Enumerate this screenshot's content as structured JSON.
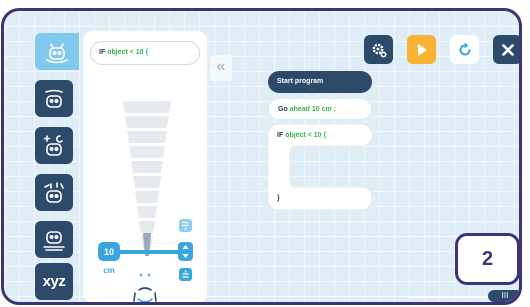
{
  "palette": {
    "if_block": {
      "keyword": "IF",
      "condition": "object < 10 {"
    },
    "sensor": {
      "value": "10",
      "unit": "cm"
    }
  },
  "program": {
    "start": "Start program",
    "go": {
      "keyword": "Go",
      "condition": "ahead 10 cm ;"
    },
    "if_block": {
      "keyword": "IF",
      "condition": "object < 10 {",
      "close": "}"
    }
  },
  "step_badge": "2",
  "scroll_thumb_label": "III",
  "colors": {
    "frame": "#3d3477",
    "navy": "#2d4a6b",
    "accent_blue": "#7fc8ee",
    "play_orange": "#f9b233",
    "keyword_green": "#39b44a",
    "slider_blue": "#3aa6e0"
  },
  "icons": {
    "categories": [
      "motion-icon",
      "sound-icon",
      "lights-icon",
      "music-icon",
      "sensor-icon",
      "variables-icon"
    ],
    "toolbar": [
      "settings-icon",
      "play-icon",
      "reload-icon",
      "close-icon"
    ]
  }
}
